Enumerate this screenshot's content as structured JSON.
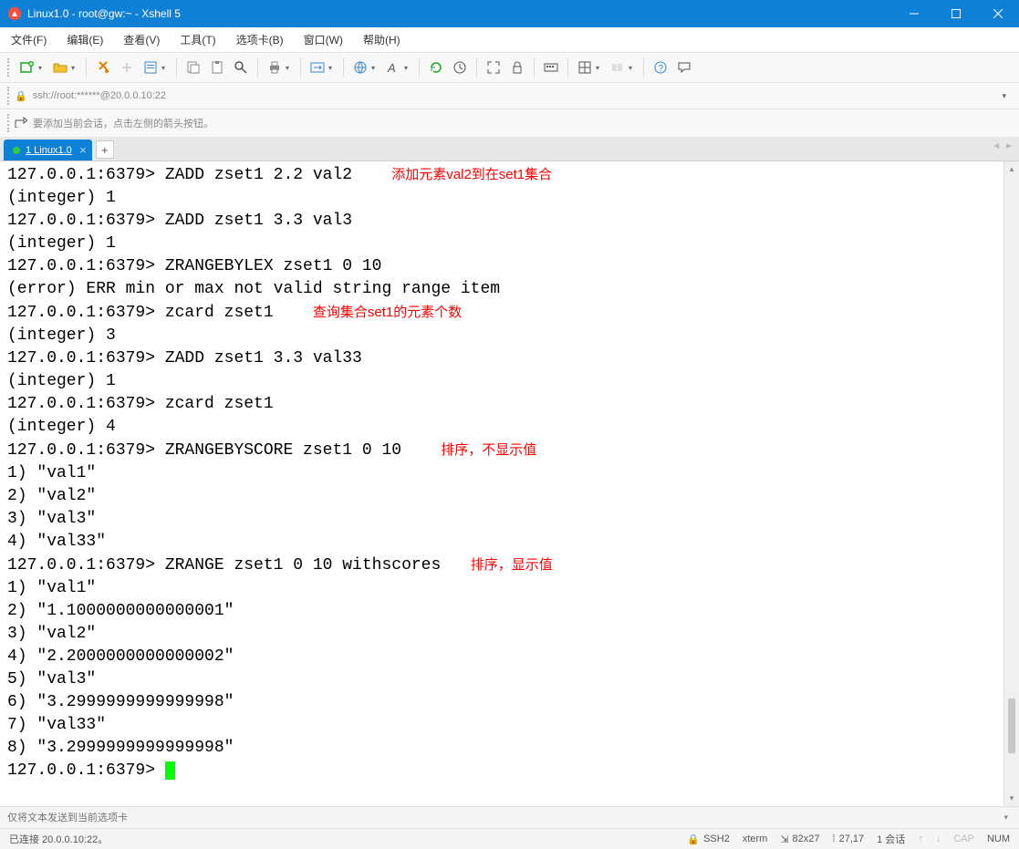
{
  "window": {
    "title": "Linux1.0 - root@gw:~ - Xshell 5"
  },
  "menu": {
    "file": "文件(F)",
    "edit": "编辑(E)",
    "view": "查看(V)",
    "tools": "工具(T)",
    "tabs": "选项卡(B)",
    "window": "窗口(W)",
    "help": "帮助(H)"
  },
  "address": {
    "url": "ssh://root:******@20.0.0.10:22"
  },
  "info": {
    "text": "要添加当前会话，点击左侧的箭头按钮。"
  },
  "tab": {
    "label": "1 Linux1.0"
  },
  "terminal": {
    "lines": [
      {
        "t": "127.0.0.1:6379> ZADD zset1 2.2 val2    ",
        "a": "添加元素val2到在set1集合"
      },
      {
        "t": "(integer) 1"
      },
      {
        "t": "127.0.0.1:6379> ZADD zset1 3.3 val3"
      },
      {
        "t": "(integer) 1"
      },
      {
        "t": "127.0.0.1:6379> ZRANGEBYLEX zset1 0 10"
      },
      {
        "t": "(error) ERR min or max not valid string range item"
      },
      {
        "t": "127.0.0.1:6379> zcard zset1    ",
        "a": "查询集合set1的元素个数"
      },
      {
        "t": "(integer) 3"
      },
      {
        "t": "127.0.0.1:6379> ZADD zset1 3.3 val33"
      },
      {
        "t": "(integer) 1"
      },
      {
        "t": "127.0.0.1:6379> zcard zset1"
      },
      {
        "t": "(integer) 4"
      },
      {
        "t": "127.0.0.1:6379> ZRANGEBYSCORE zset1 0 10    ",
        "a": "排序，不显示值"
      },
      {
        "t": "1) \"val1\""
      },
      {
        "t": "2) \"val2\""
      },
      {
        "t": "3) \"val3\""
      },
      {
        "t": "4) \"val33\""
      },
      {
        "t": "127.0.0.1:6379> ZRANGE zset1 0 10 withscores   ",
        "a": "排序，显示值"
      },
      {
        "t": "1) \"val1\""
      },
      {
        "t": "2) \"1.1000000000000001\""
      },
      {
        "t": "3) \"val2\""
      },
      {
        "t": "4) \"2.2000000000000002\""
      },
      {
        "t": "5) \"val3\""
      },
      {
        "t": "6) \"3.2999999999999998\""
      },
      {
        "t": "7) \"val33\""
      },
      {
        "t": "8) \"3.2999999999999998\""
      },
      {
        "t": "127.0.0.1:6379> ",
        "cursor": true
      }
    ]
  },
  "input": {
    "placeholder": "仅将文本发送到当前选项卡"
  },
  "status": {
    "conn": "已连接 20.0.0.10:22。",
    "proto": "SSH2",
    "term": "xterm",
    "size": "82x27",
    "pos": "27,17",
    "sessions": "1 会话",
    "cap": "CAP",
    "num": "NUM"
  }
}
